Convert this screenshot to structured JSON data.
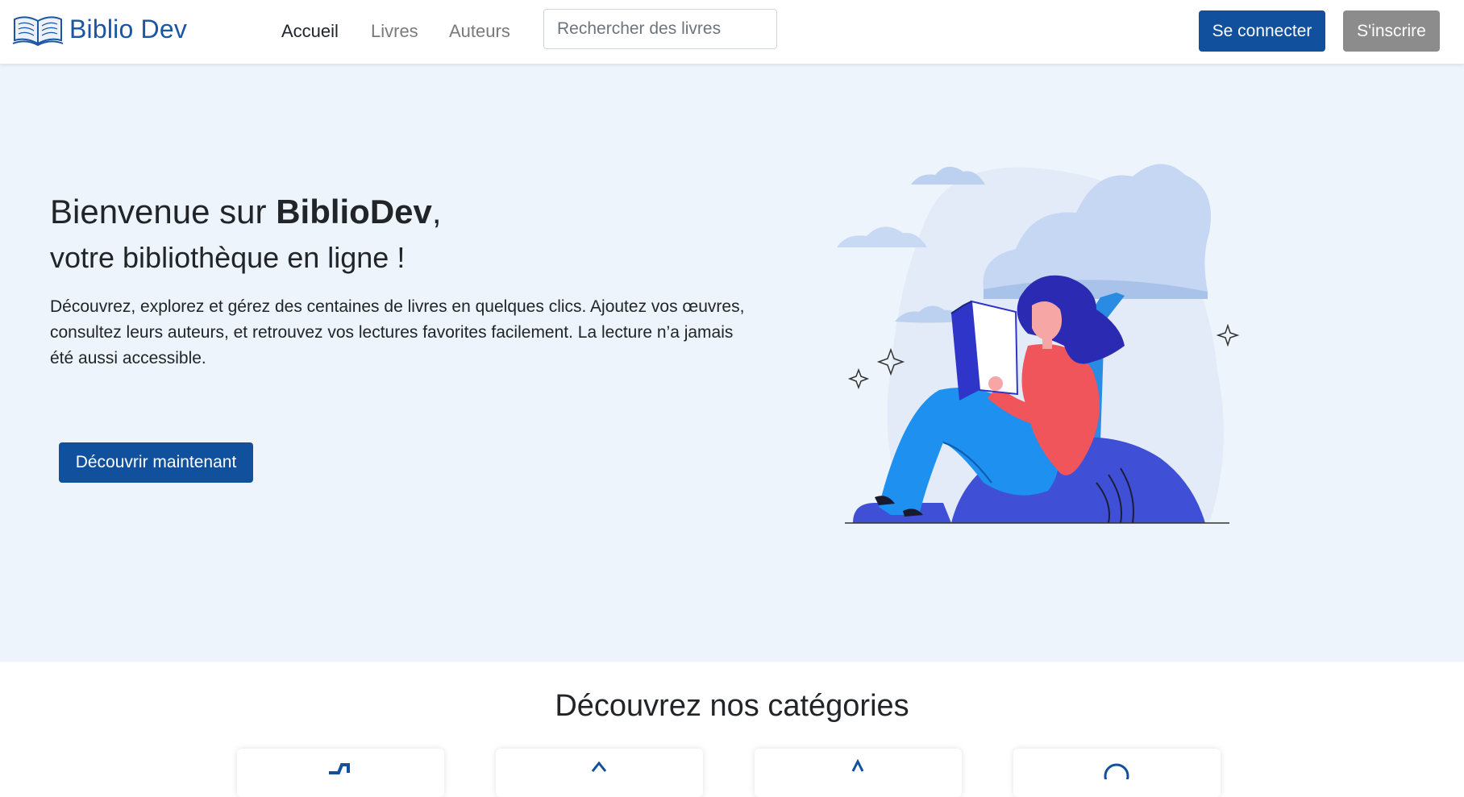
{
  "brand": {
    "name": "Biblio Dev",
    "icon": "book-icon"
  },
  "nav": {
    "items": [
      {
        "label": "Accueil",
        "active": true
      },
      {
        "label": "Livres",
        "active": false
      },
      {
        "label": "Auteurs",
        "active": false
      }
    ],
    "search_placeholder": "Rechercher des livres",
    "login_label": "Se connecter",
    "signup_label": "S'inscrire"
  },
  "hero": {
    "title_prefix": "Bienvenue sur ",
    "title_brand": "BiblioDev",
    "title_suffix": ",",
    "subtitle": "votre bibliothèque en ligne !",
    "description": "Découvrez, explorez et gérez des centaines de livres en quelques clics. Ajoutez vos œuvres, consultez leurs auteurs, et retrouvez vos lectures favorites facilement. La lecture n’a jamais été aussi accessible.",
    "cta_label": "Découvrir maintenant",
    "illustration": "woman-reading-illustration"
  },
  "categories": {
    "title": "Découvrez nos catégories",
    "cards": [
      {
        "icon": "category-icon-1"
      },
      {
        "icon": "category-icon-2"
      },
      {
        "icon": "category-icon-3"
      },
      {
        "icon": "category-icon-4"
      }
    ]
  },
  "colors": {
    "primary": "#11509c",
    "brand_text": "#1a56a3",
    "secondary_button": "#8c8c8c",
    "hero_background": "#eef4fb"
  }
}
